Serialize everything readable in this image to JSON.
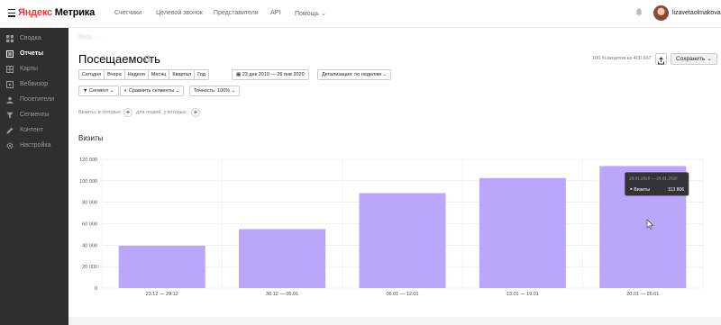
{
  "header": {
    "logo_brand": "Яндекс",
    "logo_product": "Метрика",
    "nav": [
      "Счетчики",
      "Целевой звонок",
      "Представители",
      "API",
      "Помощь"
    ],
    "username": "lizavetaolmakova"
  },
  "sidebar": {
    "items": [
      {
        "label": "Сводка",
        "icon": "grid-icon"
      },
      {
        "label": "Отчеты",
        "icon": "report-icon",
        "active": true
      },
      {
        "label": "Карты",
        "icon": "map-icon"
      },
      {
        "label": "Вебвизор",
        "icon": "play-icon"
      },
      {
        "label": "Посетители",
        "icon": "users-icon"
      },
      {
        "label": "Сегменты",
        "icon": "filter-icon"
      },
      {
        "label": "Контент",
        "icon": "pencil-icon"
      },
      {
        "label": "Настройка",
        "icon": "gear-icon"
      }
    ]
  },
  "page": {
    "breadcrumb": "Весь   ·   ·   ·",
    "title": "Посещаемость",
    "visits_share": "100 % визитов из 400 667",
    "save_label": "Сохранить"
  },
  "filters": {
    "periods": [
      "Сегодня",
      "Вчера",
      "Неделя",
      "Месяц",
      "Квартал",
      "Год"
    ],
    "date_range": "23 дек 2019 — 26 янв 2020",
    "detail": "Детализация: по неделям",
    "segment": "Сегмент",
    "compare": "Сравнить сегменты",
    "accuracy": "Точность: 100%",
    "hint_visits": "Визиты, в которых",
    "hint_people": "для людей, у которых"
  },
  "chart_data": {
    "type": "bar",
    "title": "Визиты",
    "categories": [
      "23.12 — 29.12",
      "30.12 — 05.01",
      "06.01 — 12.01",
      "13.01 — 19.01",
      "20.01 — 26.01"
    ],
    "values": [
      39500,
      55000,
      88500,
      102500,
      113806
    ],
    "ylim": [
      0,
      120000
    ],
    "yticks": [
      "0",
      "20 000",
      "40 000",
      "60 000",
      "80 000",
      "100 000",
      "120 000"
    ],
    "ytick_values": [
      0,
      20000,
      40000,
      60000,
      80000,
      100000,
      120000
    ],
    "bar_color": "#baa6fb",
    "grid": true,
    "tooltip": {
      "date": "20.01.2020 — 26.01.2020",
      "series": "Визиты",
      "value": "113 806"
    }
  }
}
